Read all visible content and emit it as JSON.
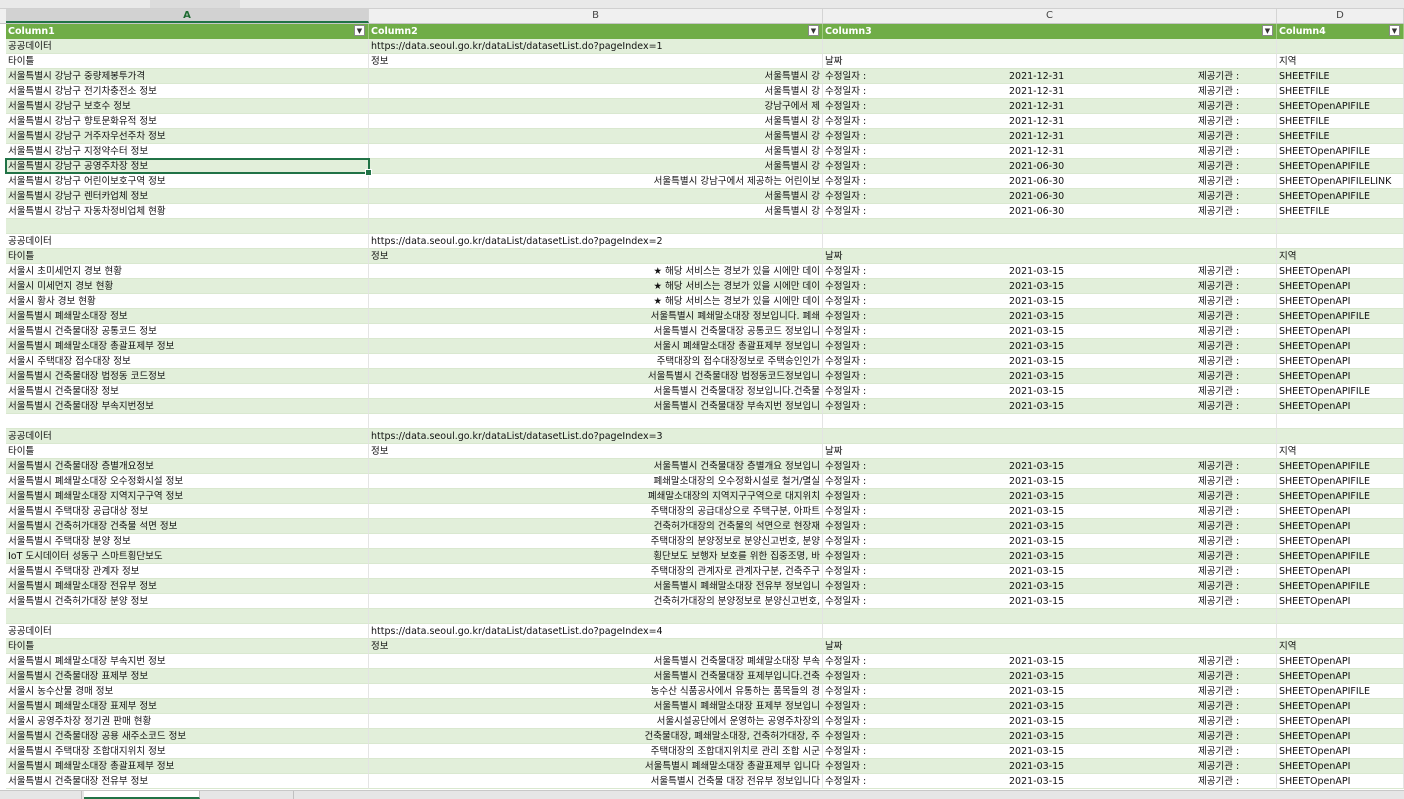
{
  "columns": {
    "a": "A",
    "b": "B",
    "c": "C",
    "d": "D"
  },
  "table_header": [
    "Column1",
    "Column2",
    "Column3",
    "Column4"
  ],
  "sheet_tabs": [
    "",
    "",
    ""
  ],
  "rows": [
    {
      "a": "공공데이터",
      "b": "https://data.seoul.go.kr/dataList/datasetList.do?pageIndex=1",
      "b2": "",
      "c": "",
      "c2": "",
      "c3": "",
      "d": ""
    },
    {
      "a": "타이틀",
      "b": "정보",
      "b2": "",
      "c": "날짜",
      "c2": "",
      "c3": "",
      "d": "지역"
    },
    {
      "a": "서울특별시 강남구 중량제봉투가격",
      "b": "",
      "b2": "서울특별시 강",
      "c": "수정일자 :",
      "c2": "2021-12-31",
      "c3": "제공기관 :",
      "d": "SHEETFILE"
    },
    {
      "a": "서울특별시 강남구 전기차충전소 정보",
      "b": "",
      "b2": "서울특별시 강",
      "c": "수정일자 :",
      "c2": "2021-12-31",
      "c3": "제공기관 :",
      "d": "SHEETFILE"
    },
    {
      "a": "서울특별시 강남구 보호수 정보",
      "b": "",
      "b2": "강남구에서 제",
      "c": "수정일자 :",
      "c2": "2021-12-31",
      "c3": "제공기관 :",
      "d": "SHEETOpenAPIFILE"
    },
    {
      "a": "서울특별시 강남구 향토문화유적 정보",
      "b": "",
      "b2": "서울특별시 강",
      "c": "수정일자 :",
      "c2": "2021-12-31",
      "c3": "제공기관 :",
      "d": "SHEETFILE"
    },
    {
      "a": "서울특별시 강남구 거주자우선주차 정보",
      "b": "",
      "b2": "서울특별시 강",
      "c": "수정일자 :",
      "c2": "2021-12-31",
      "c3": "제공기관 :",
      "d": "SHEETFILE"
    },
    {
      "a": "서울특별시 강남구 지정약수터 정보",
      "b": "",
      "b2": "서울특별시 강",
      "c": "수정일자 :",
      "c2": "2021-12-31",
      "c3": "제공기관 :",
      "d": "SHEETOpenAPIFILE"
    },
    {
      "a": "서울특별시 강남구 공영주차장 정보",
      "b": "",
      "b2": "서울특별시 강",
      "c": "수정일자 :",
      "c2": "2021-06-30",
      "c3": "제공기관 :",
      "d": "SHEETOpenAPIFILE"
    },
    {
      "a": "서울특별시 강남구 어린이보호구역 정보",
      "b": "",
      "b2": "서울특별시 강남구에서 제공하는 어린이보",
      "c": "수정일자 :",
      "c2": "2021-06-30",
      "c3": "제공기관 :",
      "d": "SHEETOpenAPIFILELINK"
    },
    {
      "a": "서울특별시 강남구 렌터카업체 정보",
      "b": "",
      "b2": "서울특별시 강",
      "c": "수정일자 :",
      "c2": "2021-06-30",
      "c3": "제공기관 :",
      "d": "SHEETOpenAPIFILE"
    },
    {
      "a": "서울특별시 강남구 자동차정비업체 현황",
      "b": "",
      "b2": "서울특별시 강",
      "c": "수정일자 :",
      "c2": "2021-06-30",
      "c3": "제공기관 :",
      "d": "SHEETFILE"
    },
    {
      "a": "",
      "b": "",
      "b2": "",
      "c": "",
      "c2": "",
      "c3": "",
      "d": ""
    },
    {
      "a": "공공데이터",
      "b": "https://data.seoul.go.kr/dataList/datasetList.do?pageIndex=2",
      "b2": "",
      "c": "",
      "c2": "",
      "c3": "",
      "d": ""
    },
    {
      "a": "타이틀",
      "b": "정보",
      "b2": "",
      "c": "날짜",
      "c2": "",
      "c3": "",
      "d": "지역"
    },
    {
      "a": "서울시 초미세먼지 경보 현황",
      "b": "",
      "b2": "★ 해당 서비스는 경보가 있을 시에만 데이",
      "c": "수정일자 :",
      "c2": "2021-03-15",
      "c3": "제공기관 :",
      "d": "SHEETOpenAPI"
    },
    {
      "a": "서울시 미세먼지 경보 현황",
      "b": "",
      "b2": "★ 해당 서비스는 경보가 있을 시에만 데이",
      "c": "수정일자 :",
      "c2": "2021-03-15",
      "c3": "제공기관 :",
      "d": "SHEETOpenAPI"
    },
    {
      "a": "서울시 황사 경보 현황",
      "b": "",
      "b2": "★ 해당 서비스는 경보가 있을 시에만 데이",
      "c": "수정일자 :",
      "c2": "2021-03-15",
      "c3": "제공기관 :",
      "d": "SHEETOpenAPI"
    },
    {
      "a": "서울특별시 폐쇄말소대장 정보",
      "b": "",
      "b2": "서울특별시 폐쇄말소대장 정보입니다. 폐쇄",
      "c": "수정일자 :",
      "c2": "2021-03-15",
      "c3": "제공기관 :",
      "d": "SHEETOpenAPIFILE"
    },
    {
      "a": "서울특별시 건축물대장 공통코드 정보",
      "b": "",
      "b2": "서울특별시 건축물대장 공통코드 정보입니",
      "c": "수정일자 :",
      "c2": "2021-03-15",
      "c3": "제공기관 :",
      "d": "SHEETOpenAPI"
    },
    {
      "a": "서울특별시 폐쇄말소대장 총괄표제부 정보",
      "b": "",
      "b2": "서울시 폐쇄말소대장 총괄표제부 정보입니",
      "c": "수정일자 :",
      "c2": "2021-03-15",
      "c3": "제공기관 :",
      "d": "SHEETOpenAPI"
    },
    {
      "a": "서울시 주택대장 접수대장 정보",
      "b": "",
      "b2": "주택대장의 접수대장정보로 주택승인인가",
      "c": "수정일자 :",
      "c2": "2021-03-15",
      "c3": "제공기관 :",
      "d": "SHEETOpenAPI"
    },
    {
      "a": "서울특별시 건축물대장 법정동 코드정보",
      "b": "",
      "b2": "서울특별시 건축물대장 법정동코드정보입니",
      "c": "수정일자 :",
      "c2": "2021-03-15",
      "c3": "제공기관 :",
      "d": "SHEETOpenAPI"
    },
    {
      "a": "서울특별시 건축물대장 정보",
      "b": "",
      "b2": "서울특별시 건축물대장 정보입니다.건축물",
      "c": "수정일자 :",
      "c2": "2021-03-15",
      "c3": "제공기관 :",
      "d": "SHEETOpenAPIFILE"
    },
    {
      "a": "서울특별시 건축물대장 부속지번정보",
      "b": "",
      "b2": "서울특별시 건축물대장 부속지번 정보입니",
      "c": "수정일자 :",
      "c2": "2021-03-15",
      "c3": "제공기관 :",
      "d": "SHEETOpenAPI"
    },
    {
      "a": "",
      "b": "",
      "b2": "",
      "c": "",
      "c2": "",
      "c3": "",
      "d": ""
    },
    {
      "a": "공공데이터",
      "b": "https://data.seoul.go.kr/dataList/datasetList.do?pageIndex=3",
      "b2": "",
      "c": "",
      "c2": "",
      "c3": "",
      "d": ""
    },
    {
      "a": "타이틀",
      "b": "정보",
      "b2": "",
      "c": "날짜",
      "c2": "",
      "c3": "",
      "d": "지역"
    },
    {
      "a": "서울특별시 건축물대장 층별개요정보",
      "b": "",
      "b2": "서울특별시 건축물대장 층별개요 정보입니",
      "c": "수정일자 :",
      "c2": "2021-03-15",
      "c3": "제공기관 :",
      "d": "SHEETOpenAPIFILE"
    },
    {
      "a": "서울특별시 폐쇄말소대장 오수정화시설 정보",
      "b": "",
      "b2": "폐쇄말소대장의 오수정화시설로 철거/멸실",
      "c": "수정일자 :",
      "c2": "2021-03-15",
      "c3": "제공기관 :",
      "d": "SHEETOpenAPIFILE"
    },
    {
      "a": "서울특별시 폐쇄말소대장 지역지구구역 정보",
      "b": "",
      "b2": "폐쇄말소대장의 지역지구구역으로 대지위치",
      "c": "수정일자 :",
      "c2": "2021-03-15",
      "c3": "제공기관 :",
      "d": "SHEETOpenAPIFILE"
    },
    {
      "a": "서울특별시 주택대장 공급대상 정보",
      "b": "",
      "b2": "주택대장의 공급대상으로 주택구분, 아파트",
      "c": "수정일자 :",
      "c2": "2021-03-15",
      "c3": "제공기관 :",
      "d": "SHEETOpenAPI"
    },
    {
      "a": "서울특별시 건축허가대장 건축물 석면 정보",
      "b": "",
      "b2": "건축허가대장의 건축물의 석면으로 현장재",
      "c": "수정일자 :",
      "c2": "2021-03-15",
      "c3": "제공기관 :",
      "d": "SHEETOpenAPI"
    },
    {
      "a": "서울특별시 주택대장 분양 정보",
      "b": "",
      "b2": "주택대장의 분양정보로 분양신고번호, 분양",
      "c": "수정일자 :",
      "c2": "2021-03-15",
      "c3": "제공기관 :",
      "d": "SHEETOpenAPI"
    },
    {
      "a": "IoT 도시데이터 성동구 스마트횡단보도",
      "b": "",
      "b2": "횡단보도 보행자 보호를 위한 집중조명, 바",
      "c": "수정일자 :",
      "c2": "2021-03-15",
      "c3": "제공기관 :",
      "d": "SHEETOpenAPIFILE"
    },
    {
      "a": "서울특별시 주택대장 관계자 정보",
      "b": "",
      "b2": "주택대장의 관계자로 관계자구분, 건축주구",
      "c": "수정일자 :",
      "c2": "2021-03-15",
      "c3": "제공기관 :",
      "d": "SHEETOpenAPI"
    },
    {
      "a": "서울특별시 폐쇄말소대장 전유부 정보",
      "b": "",
      "b2": "서울특별시 폐쇄말소대장 전유부 정보입니",
      "c": "수정일자 :",
      "c2": "2021-03-15",
      "c3": "제공기관 :",
      "d": "SHEETOpenAPIFILE"
    },
    {
      "a": "서울특별시 건축허가대장 분양 정보",
      "b": "",
      "b2": "건축허가대장의 분양정보로 분양신고번호,",
      "c": "수정일자 :",
      "c2": "2021-03-15",
      "c3": "제공기관 :",
      "d": "SHEETOpenAPI"
    },
    {
      "a": "",
      "b": "",
      "b2": "",
      "c": "",
      "c2": "",
      "c3": "",
      "d": ""
    },
    {
      "a": "공공데이터",
      "b": "https://data.seoul.go.kr/dataList/datasetList.do?pageIndex=4",
      "b2": "",
      "c": "",
      "c2": "",
      "c3": "",
      "d": ""
    },
    {
      "a": "타이틀",
      "b": "정보",
      "b2": "",
      "c": "날짜",
      "c2": "",
      "c3": "",
      "d": "지역"
    },
    {
      "a": "서울특별시 폐쇄말소대장 부속지번 정보",
      "b": "",
      "b2": "서울특별시 건축물대장 폐쇄말소대장 부속",
      "c": "수정일자 :",
      "c2": "2021-03-15",
      "c3": "제공기관 :",
      "d": "SHEETOpenAPI"
    },
    {
      "a": "서울특별시 건축물대장 표제부 정보",
      "b": "",
      "b2": "서울특별시 건축물대장 표제부입니다.건축",
      "c": "수정일자 :",
      "c2": "2021-03-15",
      "c3": "제공기관 :",
      "d": "SHEETOpenAPI"
    },
    {
      "a": "서울시 농수산물 경매 정보",
      "b": "",
      "b2": "농수산 식품공사에서 유통하는 품목들의 경",
      "c": "수정일자 :",
      "c2": "2021-03-15",
      "c3": "제공기관 :",
      "d": "SHEETOpenAPIFILE"
    },
    {
      "a": "서울특별시 폐쇄말소대장 표제부 정보",
      "b": "",
      "b2": "서울특별시 폐쇄말소대장 표제부 정보입니",
      "c": "수정일자 :",
      "c2": "2021-03-15",
      "c3": "제공기관 :",
      "d": "SHEETOpenAPI"
    },
    {
      "a": "서울시 공영주차장 정기권 판매 현황",
      "b": "",
      "b2": "서울시설공단에서 운영하는 공영주차장의",
      "c": "수정일자 :",
      "c2": "2021-03-15",
      "c3": "제공기관 :",
      "d": "SHEETOpenAPI"
    },
    {
      "a": "서울특별시 건축물대장 공용 새주소코드 정보",
      "b": "",
      "b2": "건축물대장, 폐쇄말소대장, 건축허가대장, 주",
      "c": "수정일자 :",
      "c2": "2021-03-15",
      "c3": "제공기관 :",
      "d": "SHEETOpenAPI"
    },
    {
      "a": "서울특별시 주택대장 조합대지위치 정보",
      "b": "",
      "b2": "주택대장의 조합대지위치로 관리 조합 시군",
      "c": "수정일자 :",
      "c2": "2021-03-15",
      "c3": "제공기관 :",
      "d": "SHEETOpenAPI"
    },
    {
      "a": "서울특별시 폐쇄말소대장 총괄표제부 정보",
      "b": "",
      "b2": "서울특별시 폐쇄말소대장 총괄표제부 입니다",
      "c": "수정일자 :",
      "c2": "2021-03-15",
      "c3": "제공기관 :",
      "d": "SHEETOpenAPI"
    },
    {
      "a": "서울특별시 건축물대장 전유부 정보",
      "b": "",
      "b2": "서울특별시 건축물 대장 전유부 정보입니다",
      "c": "수정일자 :",
      "c2": "2021-03-15",
      "c3": "제공기관 :",
      "d": "SHEETOpenAPI"
    }
  ]
}
